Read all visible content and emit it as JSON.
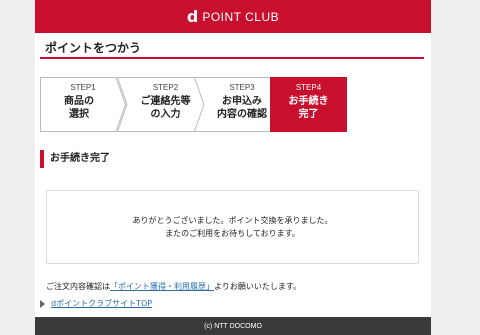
{
  "header": {
    "logo_mark": "d",
    "logo_text": "POINT CLUB",
    "brand_color": "#c8102e"
  },
  "page": {
    "title": "ポイントをつかう"
  },
  "steps": [
    {
      "label": "STEP1",
      "name": "商品の\n選択",
      "active": false
    },
    {
      "label": "STEP2",
      "name": "ご連絡先等\nの入力",
      "active": false
    },
    {
      "label": "STEP3",
      "name": "お申込み\n内容の確認",
      "active": false
    },
    {
      "label": "STEP4",
      "name": "お手続き\n完了",
      "active": true
    }
  ],
  "section": {
    "heading": "お手続き完了"
  },
  "message": {
    "line1": "ありがとうございました。ポイント交換を承りました。",
    "line2": "またのご利用をお待ちしております。"
  },
  "note": {
    "prefix": "ご注文内容確認は",
    "link": "「ポイント獲得・利用履歴」",
    "suffix": "よりお願いいたします。"
  },
  "links": {
    "top": "dポイントクラブサイトTOP"
  },
  "footer": {
    "copyright": "(c) NTT DOCOMO"
  }
}
